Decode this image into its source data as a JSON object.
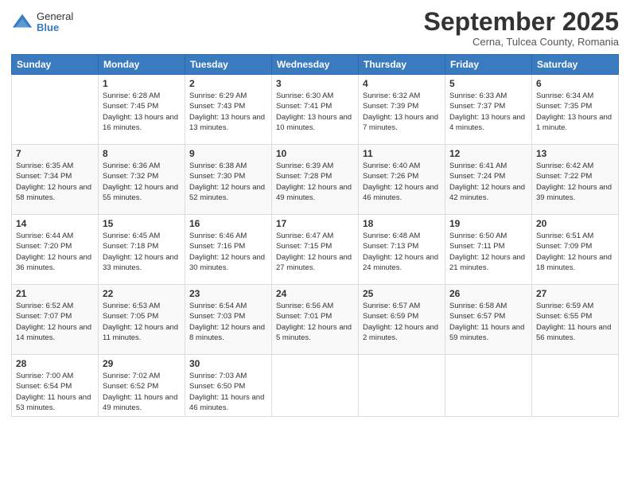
{
  "logo": {
    "general": "General",
    "blue": "Blue"
  },
  "header": {
    "month": "September 2025",
    "location": "Cerna, Tulcea County, Romania"
  },
  "weekdays": [
    "Sunday",
    "Monday",
    "Tuesday",
    "Wednesday",
    "Thursday",
    "Friday",
    "Saturday"
  ],
  "weeks": [
    [
      {
        "day": "",
        "sunrise": "",
        "sunset": "",
        "daylight": ""
      },
      {
        "day": "1",
        "sunrise": "Sunrise: 6:28 AM",
        "sunset": "Sunset: 7:45 PM",
        "daylight": "Daylight: 13 hours and 16 minutes."
      },
      {
        "day": "2",
        "sunrise": "Sunrise: 6:29 AM",
        "sunset": "Sunset: 7:43 PM",
        "daylight": "Daylight: 13 hours and 13 minutes."
      },
      {
        "day": "3",
        "sunrise": "Sunrise: 6:30 AM",
        "sunset": "Sunset: 7:41 PM",
        "daylight": "Daylight: 13 hours and 10 minutes."
      },
      {
        "day": "4",
        "sunrise": "Sunrise: 6:32 AM",
        "sunset": "Sunset: 7:39 PM",
        "daylight": "Daylight: 13 hours and 7 minutes."
      },
      {
        "day": "5",
        "sunrise": "Sunrise: 6:33 AM",
        "sunset": "Sunset: 7:37 PM",
        "daylight": "Daylight: 13 hours and 4 minutes."
      },
      {
        "day": "6",
        "sunrise": "Sunrise: 6:34 AM",
        "sunset": "Sunset: 7:35 PM",
        "daylight": "Daylight: 13 hours and 1 minute."
      }
    ],
    [
      {
        "day": "7",
        "sunrise": "Sunrise: 6:35 AM",
        "sunset": "Sunset: 7:34 PM",
        "daylight": "Daylight: 12 hours and 58 minutes."
      },
      {
        "day": "8",
        "sunrise": "Sunrise: 6:36 AM",
        "sunset": "Sunset: 7:32 PM",
        "daylight": "Daylight: 12 hours and 55 minutes."
      },
      {
        "day": "9",
        "sunrise": "Sunrise: 6:38 AM",
        "sunset": "Sunset: 7:30 PM",
        "daylight": "Daylight: 12 hours and 52 minutes."
      },
      {
        "day": "10",
        "sunrise": "Sunrise: 6:39 AM",
        "sunset": "Sunset: 7:28 PM",
        "daylight": "Daylight: 12 hours and 49 minutes."
      },
      {
        "day": "11",
        "sunrise": "Sunrise: 6:40 AM",
        "sunset": "Sunset: 7:26 PM",
        "daylight": "Daylight: 12 hours and 46 minutes."
      },
      {
        "day": "12",
        "sunrise": "Sunrise: 6:41 AM",
        "sunset": "Sunset: 7:24 PM",
        "daylight": "Daylight: 12 hours and 42 minutes."
      },
      {
        "day": "13",
        "sunrise": "Sunrise: 6:42 AM",
        "sunset": "Sunset: 7:22 PM",
        "daylight": "Daylight: 12 hours and 39 minutes."
      }
    ],
    [
      {
        "day": "14",
        "sunrise": "Sunrise: 6:44 AM",
        "sunset": "Sunset: 7:20 PM",
        "daylight": "Daylight: 12 hours and 36 minutes."
      },
      {
        "day": "15",
        "sunrise": "Sunrise: 6:45 AM",
        "sunset": "Sunset: 7:18 PM",
        "daylight": "Daylight: 12 hours and 33 minutes."
      },
      {
        "day": "16",
        "sunrise": "Sunrise: 6:46 AM",
        "sunset": "Sunset: 7:16 PM",
        "daylight": "Daylight: 12 hours and 30 minutes."
      },
      {
        "day": "17",
        "sunrise": "Sunrise: 6:47 AM",
        "sunset": "Sunset: 7:15 PM",
        "daylight": "Daylight: 12 hours and 27 minutes."
      },
      {
        "day": "18",
        "sunrise": "Sunrise: 6:48 AM",
        "sunset": "Sunset: 7:13 PM",
        "daylight": "Daylight: 12 hours and 24 minutes."
      },
      {
        "day": "19",
        "sunrise": "Sunrise: 6:50 AM",
        "sunset": "Sunset: 7:11 PM",
        "daylight": "Daylight: 12 hours and 21 minutes."
      },
      {
        "day": "20",
        "sunrise": "Sunrise: 6:51 AM",
        "sunset": "Sunset: 7:09 PM",
        "daylight": "Daylight: 12 hours and 18 minutes."
      }
    ],
    [
      {
        "day": "21",
        "sunrise": "Sunrise: 6:52 AM",
        "sunset": "Sunset: 7:07 PM",
        "daylight": "Daylight: 12 hours and 14 minutes."
      },
      {
        "day": "22",
        "sunrise": "Sunrise: 6:53 AM",
        "sunset": "Sunset: 7:05 PM",
        "daylight": "Daylight: 12 hours and 11 minutes."
      },
      {
        "day": "23",
        "sunrise": "Sunrise: 6:54 AM",
        "sunset": "Sunset: 7:03 PM",
        "daylight": "Daylight: 12 hours and 8 minutes."
      },
      {
        "day": "24",
        "sunrise": "Sunrise: 6:56 AM",
        "sunset": "Sunset: 7:01 PM",
        "daylight": "Daylight: 12 hours and 5 minutes."
      },
      {
        "day": "25",
        "sunrise": "Sunrise: 6:57 AM",
        "sunset": "Sunset: 6:59 PM",
        "daylight": "Daylight: 12 hours and 2 minutes."
      },
      {
        "day": "26",
        "sunrise": "Sunrise: 6:58 AM",
        "sunset": "Sunset: 6:57 PM",
        "daylight": "Daylight: 11 hours and 59 minutes."
      },
      {
        "day": "27",
        "sunrise": "Sunrise: 6:59 AM",
        "sunset": "Sunset: 6:55 PM",
        "daylight": "Daylight: 11 hours and 56 minutes."
      }
    ],
    [
      {
        "day": "28",
        "sunrise": "Sunrise: 7:00 AM",
        "sunset": "Sunset: 6:54 PM",
        "daylight": "Daylight: 11 hours and 53 minutes."
      },
      {
        "day": "29",
        "sunrise": "Sunrise: 7:02 AM",
        "sunset": "Sunset: 6:52 PM",
        "daylight": "Daylight: 11 hours and 49 minutes."
      },
      {
        "day": "30",
        "sunrise": "Sunrise: 7:03 AM",
        "sunset": "Sunset: 6:50 PM",
        "daylight": "Daylight: 11 hours and 46 minutes."
      },
      {
        "day": "",
        "sunrise": "",
        "sunset": "",
        "daylight": ""
      },
      {
        "day": "",
        "sunrise": "",
        "sunset": "",
        "daylight": ""
      },
      {
        "day": "",
        "sunrise": "",
        "sunset": "",
        "daylight": ""
      },
      {
        "day": "",
        "sunrise": "",
        "sunset": "",
        "daylight": ""
      }
    ]
  ]
}
